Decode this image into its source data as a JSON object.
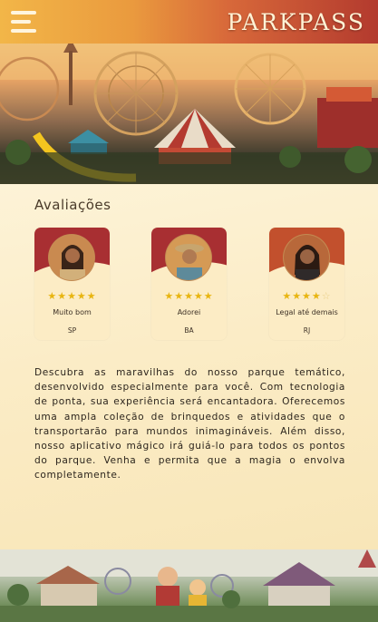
{
  "header": {
    "brand": "PARKPASS",
    "menu_icon": "hamburger-menu-icon"
  },
  "reviews": {
    "title": "Avaliações",
    "items": [
      {
        "stars": 5,
        "stars_text": "★★★★★",
        "label": "Muito bom",
        "state": "SP",
        "band_color": "#a82f32"
      },
      {
        "stars": 5,
        "stars_text": "★★★★★",
        "label": "Adorei",
        "state": "BA",
        "band_color": "#a82f32"
      },
      {
        "stars": 4,
        "stars_text": "★★★★",
        "stars_off_text": "☆",
        "label": "Legal até demais",
        "state": "RJ",
        "band_color": "#c2502d"
      }
    ]
  },
  "description": "Descubra as maravilhas do nosso parque temático, desenvolvido especialmente para você. Com tecnologia de ponta, sua experiência será encantadora. Oferecemos uma ampla coleção de brinquedos e atividades que o transportarão para mundos inimagináveis. Além disso, nosso aplicativo mágico irá guiá-lo para todos os pontos do parque. Venha e permita que a magia o envolva completamente.",
  "colors": {
    "star": "#e8b511",
    "header_start": "#f2b648",
    "header_end": "#b33a2e"
  }
}
